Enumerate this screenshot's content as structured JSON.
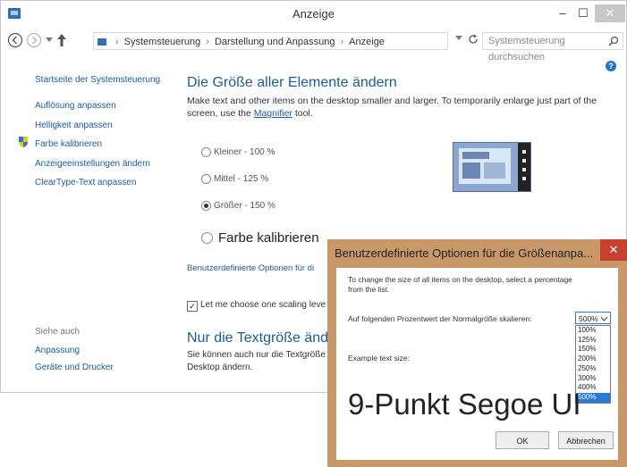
{
  "window": {
    "title": "Anzeige",
    "minimize_glyph": "–",
    "maximize_glyph": "☐",
    "close_glyph": "✕"
  },
  "nav": {
    "breadcrumb": [
      "Systemsteuerung",
      "Darstellung und Anpassung",
      "Anzeige"
    ],
    "separator": "›",
    "search_placeholder": "Systemsteuerung durchsuchen"
  },
  "sidebar": {
    "items": [
      {
        "label": "Startseite der Systemsteuerung"
      },
      {
        "label": "Auflösung anpassen"
      },
      {
        "label": "Helligkeit anpassen"
      },
      {
        "label": "Farbe kalibrieren"
      },
      {
        "label": "Anzeigeeinstellungen ändern"
      },
      {
        "label": "ClearType-Text anpassen"
      }
    ],
    "see_also_heading": "Siehe auch",
    "see_also": [
      {
        "label": "Anpassung"
      },
      {
        "label": "Geräte und Drucker"
      }
    ]
  },
  "main": {
    "heading": "Die Größe aller Elemente ändern",
    "intro_line1": "Make text and other items on the desktop smaller and larger. To temporarily enlarge just part of the",
    "intro_line2_prefix": "screen, use the ",
    "intro_link": "Magnifier",
    "intro_line2_suffix": " tool.",
    "options": [
      {
        "label": "Kleiner - 100 %",
        "selected": false
      },
      {
        "label": "Mittel - 125 %",
        "selected": false
      },
      {
        "label": "Größer - 150 %",
        "selected": true
      }
    ],
    "big_option": "Farbe kalibrieren",
    "custom_link": "Benutzerdefinierte Optionen für di",
    "checkbox_label": "Let me choose one scaling leve",
    "checkbox_checked": true,
    "checkbox_mark": "✓",
    "text_heading": "Nur die Textgröße ändern",
    "text_line1": "Sie können auch nur die Textgröße",
    "text_line2": "Desktop ändern."
  },
  "dialog": {
    "title": "Benutzerdefinierte Optionen für die Größenanpa...",
    "close_glyph": "✕",
    "instruction_line1": "To change the size of all items on the desktop, select a percentage",
    "instruction_line2": "from the list.",
    "scale_label": "Auf folgenden Prozentwert der Normalgröße skalieren:",
    "selected_value": "500%",
    "options": [
      "100%",
      "125%",
      "150%",
      "200%",
      "250%",
      "300%",
      "400%",
      "500%"
    ],
    "highlighted_option": "500%",
    "example_label": "Example text size:",
    "sample_text": "9-Punkt Segoe UI",
    "ok_label": "OK",
    "cancel_label": "Abbrechen"
  },
  "colors": {
    "link": "#1a5aa6",
    "heading": "#1b5a9f",
    "dialog_frame": "#c89868",
    "dialog_close": "#c9402f",
    "highlight": "#2a7ad8"
  }
}
